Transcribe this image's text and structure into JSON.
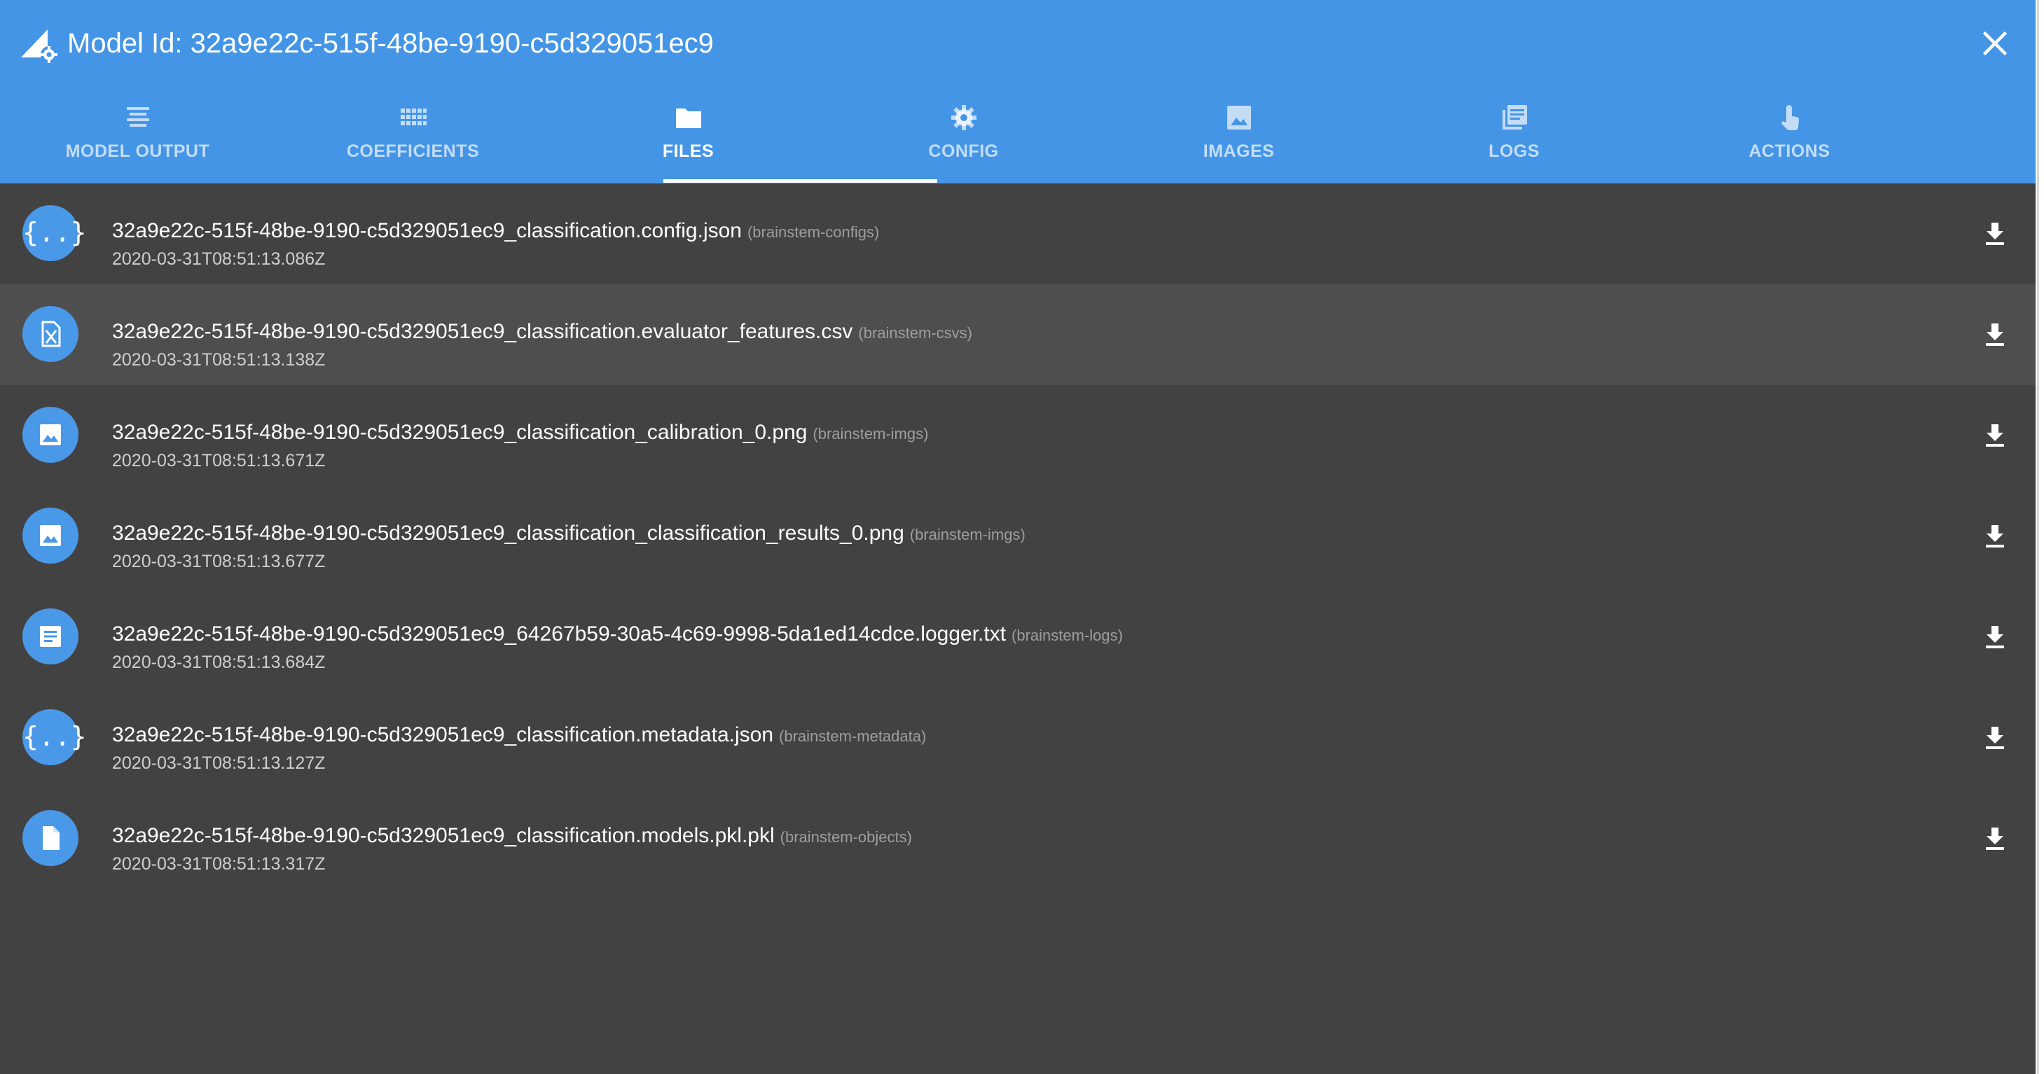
{
  "header": {
    "title": "Model Id: 32a9e22c-515f-48be-9190-c5d329051ec9",
    "app_icon": "model-gear-icon",
    "close_icon": "close-icon"
  },
  "tabs": [
    {
      "label": "MODEL OUTPUT",
      "icon": "subject-icon",
      "active": false
    },
    {
      "label": "COEFFICIENTS",
      "icon": "grid-icon",
      "active": false
    },
    {
      "label": "FILES",
      "icon": "folder-icon",
      "active": true
    },
    {
      "label": "CONFIG",
      "icon": "gear-icon",
      "active": false
    },
    {
      "label": "IMAGES",
      "icon": "image-icon",
      "active": false
    },
    {
      "label": "LOGS",
      "icon": "library-books-icon",
      "active": false
    },
    {
      "label": "ACTIONS",
      "icon": "touch-app-icon",
      "active": false
    }
  ],
  "files": [
    {
      "name": "32a9e22c-515f-48be-9190-c5d329051ec9_classification.config.json",
      "bucket": "(brainstem-configs)",
      "date": "2020-03-31T08:51:13.086Z",
      "icon": "json-icon"
    },
    {
      "name": "32a9e22c-515f-48be-9190-c5d329051ec9_classification.evaluator_features.csv",
      "bucket": "(brainstem-csvs)",
      "date": "2020-03-31T08:51:13.138Z",
      "icon": "spreadsheet-icon"
    },
    {
      "name": "32a9e22c-515f-48be-9190-c5d329051ec9_classification_calibration_0.png",
      "bucket": "(brainstem-imgs)",
      "date": "2020-03-31T08:51:13.671Z",
      "icon": "image-icon"
    },
    {
      "name": "32a9e22c-515f-48be-9190-c5d329051ec9_classification_classification_results_0.png",
      "bucket": "(brainstem-imgs)",
      "date": "2020-03-31T08:51:13.677Z",
      "icon": "image-icon"
    },
    {
      "name": "32a9e22c-515f-48be-9190-c5d329051ec9_64267b59-30a5-4c69-9998-5da1ed14cdce.logger.txt",
      "bucket": "(brainstem-logs)",
      "date": "2020-03-31T08:51:13.684Z",
      "icon": "text-file-icon"
    },
    {
      "name": "32a9e22c-515f-48be-9190-c5d329051ec9_classification.metadata.json",
      "bucket": "(brainstem-metadata)",
      "date": "2020-03-31T08:51:13.127Z",
      "icon": "json-icon"
    },
    {
      "name": "32a9e22c-515f-48be-9190-c5d329051ec9_classification.models.pkl.pkl",
      "bucket": "(brainstem-objects)",
      "date": "2020-03-31T08:51:13.317Z",
      "icon": "file-icon"
    }
  ],
  "download_icon": "download-icon",
  "colors": {
    "header": "#4595e6",
    "panel": "#424242",
    "row_highlight": "#4e4e4e",
    "avatar": "#4a98e8",
    "bucket_text": "#9e9e9e"
  }
}
